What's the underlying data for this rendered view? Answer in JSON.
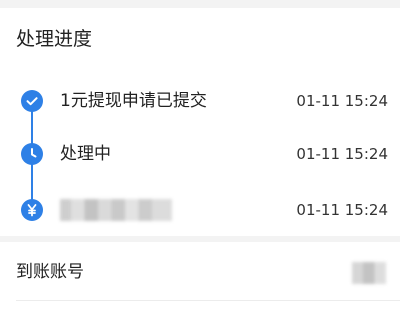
{
  "progress": {
    "title": "处理进度",
    "steps": [
      {
        "label": "1元提现申请已提交",
        "time": "01-11 15:24",
        "icon": "check-icon"
      },
      {
        "label": "处理中",
        "time": "01-11 15:24",
        "icon": "clock-icon"
      },
      {
        "label": "",
        "time": "01-11 15:24",
        "icon": "yuan-icon"
      }
    ]
  },
  "account": {
    "label": "到账账号"
  },
  "colors": {
    "accent": "#2e80e6",
    "background": "#f3f3f3"
  }
}
